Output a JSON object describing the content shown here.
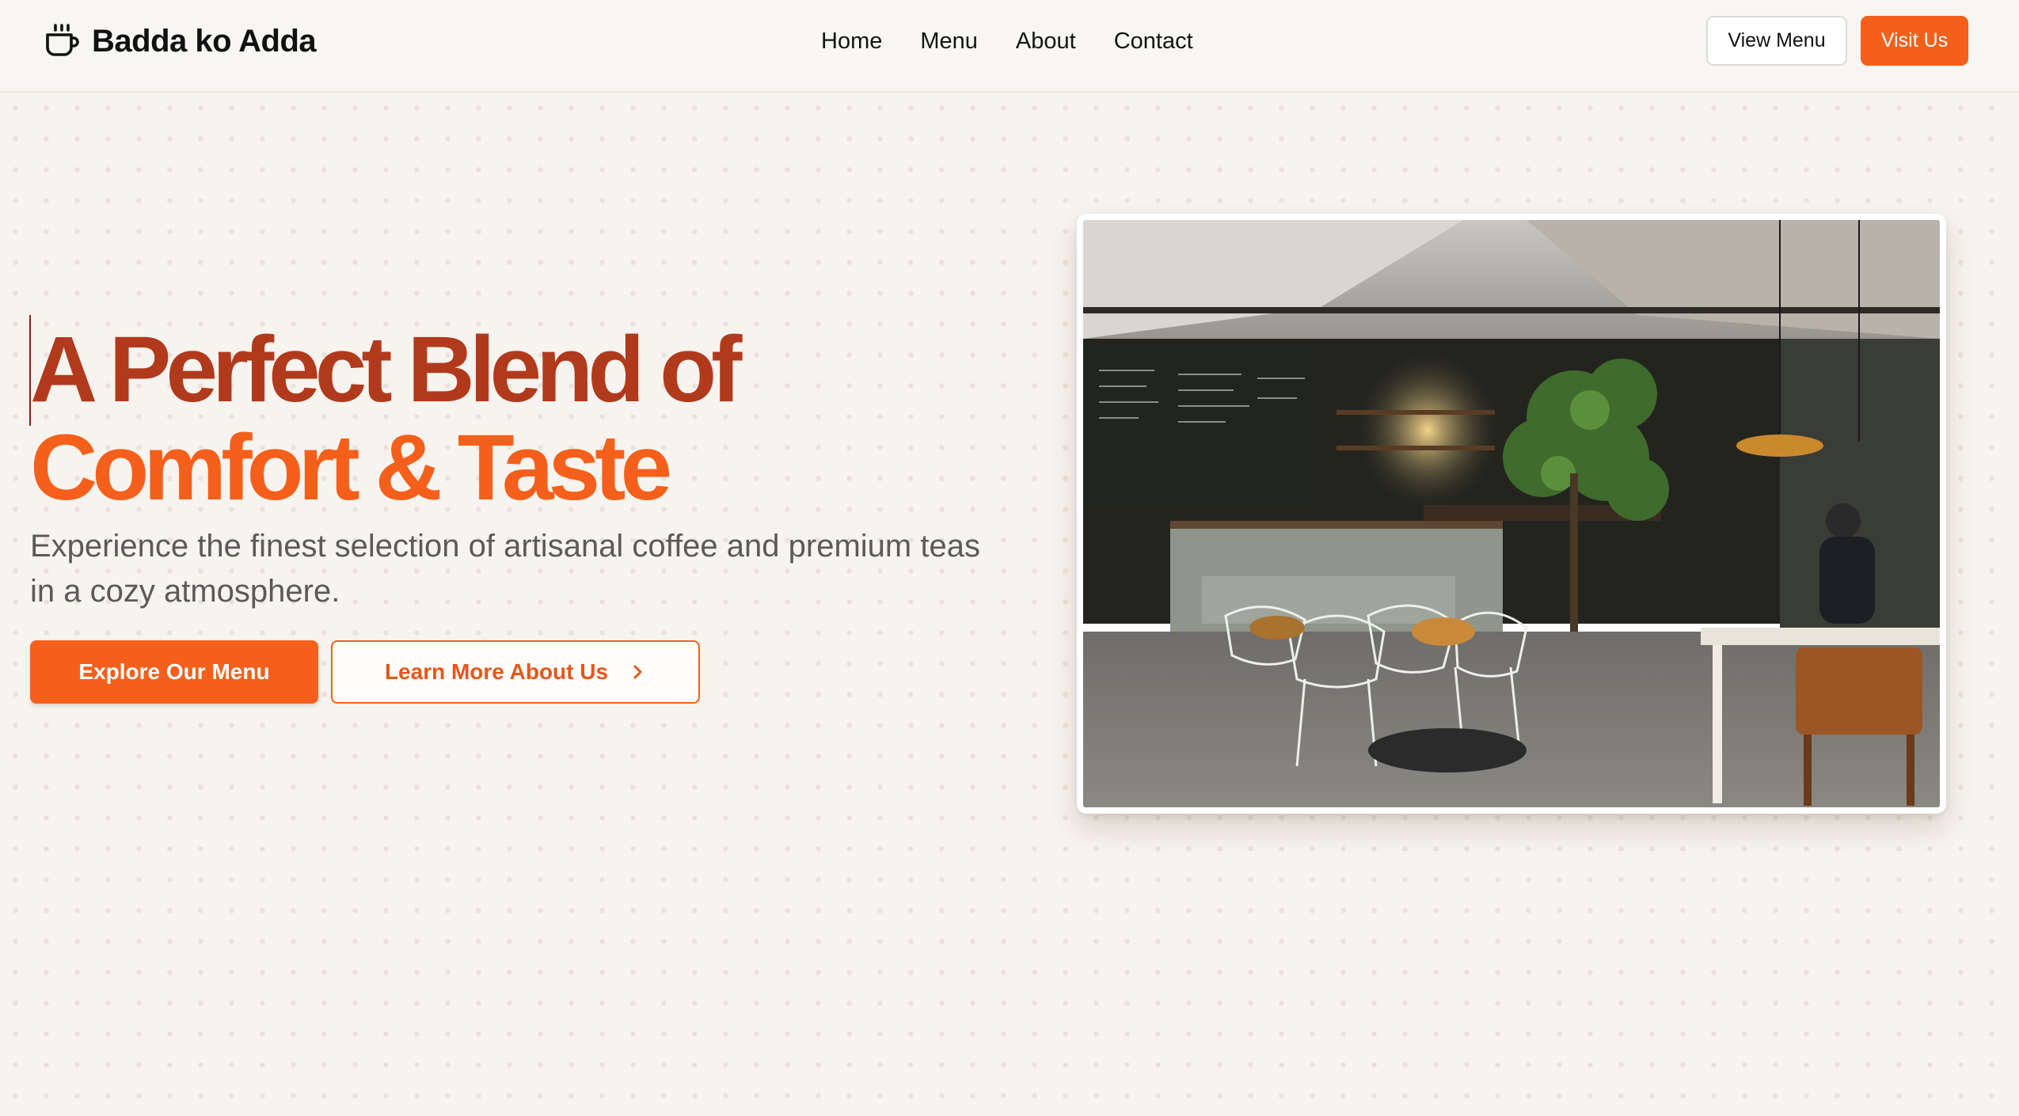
{
  "header": {
    "brand": {
      "icon": "coffee-cup-icon",
      "name": "Badda ko Adda"
    },
    "nav": [
      {
        "label": "Home"
      },
      {
        "label": "Menu"
      },
      {
        "label": "About"
      },
      {
        "label": "Contact"
      }
    ],
    "view_menu_label": "View Menu",
    "visit_us_label": "Visit Us"
  },
  "hero": {
    "title_line1": "A Perfect Blend of",
    "title_line2": "Comfort & Taste",
    "subtitle": "Experience the finest selection of artisanal coffee and premium teas in a cozy atmosphere.",
    "primary_cta": "Explore Our Menu",
    "secondary_cta": "Learn More About Us",
    "secondary_cta_icon": "chevron-right-icon",
    "image": "cafe-interior-photo"
  },
  "colors": {
    "accent": "#f4601b",
    "title_dark": "#b13a1d",
    "background": "#f7f3ee",
    "subtitle_text": "#5c5a57"
  }
}
